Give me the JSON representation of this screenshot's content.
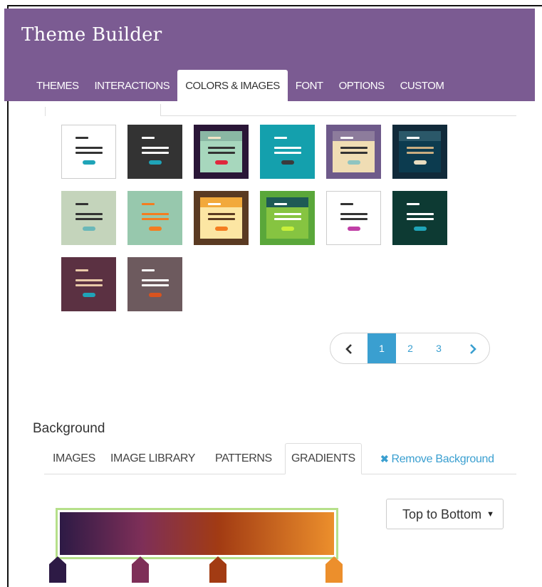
{
  "app": {
    "title": "Theme Builder"
  },
  "main_tabs": [
    {
      "label": "THEMES",
      "active": false
    },
    {
      "label": "INTERACTIONS",
      "active": false
    },
    {
      "label": "COLORS & IMAGES",
      "active": true
    },
    {
      "label": "FONT",
      "active": false
    },
    {
      "label": "OPTIONS",
      "active": false
    },
    {
      "label": "CUSTOM",
      "active": false
    }
  ],
  "color_presets": [
    {
      "name": "white-teal",
      "bg": "#ffffff",
      "border": "#cccccc",
      "lines": "#333333",
      "bar": "#333333",
      "button": "#1fa4b8",
      "panel": null
    },
    {
      "name": "charcoal-teal",
      "bg": "#333333",
      "border": "#333333",
      "lines": "#ffffff",
      "bar": "#ffffff",
      "button": "#1fa4b8",
      "panel": null
    },
    {
      "name": "plum-mint-red",
      "bg": "#2a1637",
      "border": "#2a1637",
      "lines": "#333333",
      "bar": "#f2e6c8",
      "button": "#e0273d",
      "panel": "#a7d7bd",
      "panel_top": "#8ab7a4"
    },
    {
      "name": "teal",
      "bg": "#14a0ad",
      "border": "#14a0ad",
      "lines": "#ffffff",
      "bar": "#ffffff",
      "button": "#3b3b3b",
      "panel": null
    },
    {
      "name": "purple-sand",
      "bg": "#6e5a8a",
      "border": "#6e5a8a",
      "lines": "#333333",
      "bar": "#ffffff",
      "button": "#8fc5c1",
      "panel": "#f0ddb4",
      "panel_top": "#8d7c9c"
    },
    {
      "name": "navy-tan",
      "bg": "#112a3a",
      "border": "#112a3a",
      "lines": "#c9ad80",
      "bar": "#ffffff",
      "button": "#e9dcc0",
      "panel": "#0c3b4f",
      "panel_top": "#2b5869"
    },
    {
      "name": "sage-teal",
      "bg": "#c4d4bb",
      "border": "#c4d4bb",
      "lines": "#333333",
      "bar": "#333333",
      "button": "#6ab8b9",
      "panel": null
    },
    {
      "name": "mint-orange",
      "bg": "#97c8ad",
      "border": "#97c8ad",
      "lines": "#f47d20",
      "bar": "#f47d20",
      "button": "#f47d20",
      "panel": null
    },
    {
      "name": "brown-gold",
      "bg": "#5a3a22",
      "border": "#5a3a22",
      "lines": "#5a3a22",
      "bar": "#ffffff",
      "button": "#f47d20",
      "panel": "#fce6a3",
      "panel_top": "#f2a93b"
    },
    {
      "name": "green-lime",
      "bg": "#5aa73a",
      "border": "#5aa73a",
      "lines": "#ffffff",
      "bar": "#ffffff",
      "button": "#c9f03a",
      "panel": "#86c441",
      "panel_top": "#1e5a55"
    },
    {
      "name": "white-magenta",
      "bg": "#ffffff",
      "border": "#cccccc",
      "lines": "#333333",
      "bar": "#333333",
      "button": "#c03fa6",
      "panel": null
    },
    {
      "name": "dark-green-teal",
      "bg": "#0d3a33",
      "border": "#0d3a33",
      "lines": "#ffffff",
      "bar": "#ffffff",
      "button": "#1fa4b8",
      "panel": null
    },
    {
      "name": "aubergine-teal",
      "bg": "#5b3142",
      "border": "#5b3142",
      "lines": "#e9c9a8",
      "bar": "#e9c9a8",
      "button": "#1fa4b8",
      "panel": null
    },
    {
      "name": "mauve-orange",
      "bg": "#6d5a5e",
      "border": "#6d5a5e",
      "lines": "#ffffff",
      "bar": "#ffffff",
      "button": "#d9531e",
      "panel": null
    }
  ],
  "pagination": {
    "prev_icon": "chevron-left-icon",
    "next_icon": "chevron-right-icon",
    "pages": [
      "1",
      "2",
      "3"
    ],
    "current": "1"
  },
  "background": {
    "label": "Background",
    "tabs": [
      {
        "label": "IMAGES",
        "active": false
      },
      {
        "label": "IMAGE LIBRARY",
        "active": false
      },
      {
        "label": "PATTERNS",
        "active": false
      },
      {
        "label": "GRADIENTS",
        "active": true
      }
    ],
    "remove_label": "Remove Background",
    "remove_icon": "close-icon",
    "direction_selected": "Top to Bottom",
    "gradient_stops": [
      {
        "color": "#2d1a45",
        "position": 0.0
      },
      {
        "color": "#7e2f58",
        "position": 0.3
      },
      {
        "color": "#a23b13",
        "position": 0.58
      },
      {
        "color": "#ec8f2c",
        "position": 1.0
      }
    ]
  },
  "colors": {
    "header": "#7b5b92",
    "accent": "#3a9fd0",
    "gradient_border": "#b6e08a"
  }
}
